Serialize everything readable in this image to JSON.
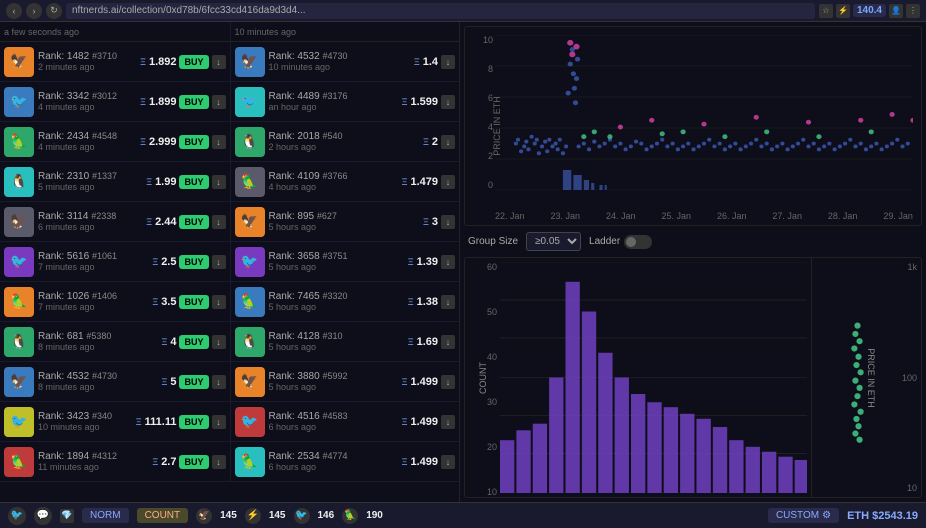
{
  "topbar": {
    "url": "nftnerds.ai/collection/0xd78b/6fcc33cd416da9d3d4...",
    "eth_price": "140.4"
  },
  "sales": [
    {
      "rank": "1482",
      "id": "#3710",
      "price": "1.892",
      "time": "2 minutes ago",
      "has_buy": true,
      "bg": "bg-orange",
      "emoji": "🦅"
    },
    {
      "rank": "3342",
      "id": "#3012",
      "price": "1.899",
      "time": "4 minutes ago",
      "has_buy": true,
      "bg": "bg-blue",
      "emoji": "🐦"
    },
    {
      "rank": "2434",
      "id": "#4548",
      "price": "2.999",
      "time": "4 minutes ago",
      "has_buy": true,
      "bg": "bg-green",
      "emoji": "🦜"
    },
    {
      "rank": "2310",
      "id": "#1337",
      "price": "1.99",
      "time": "5 minutes ago",
      "has_buy": true,
      "bg": "bg-teal",
      "emoji": "🐧"
    },
    {
      "rank": "3114",
      "id": "#2338",
      "price": "2.44",
      "time": "6 minutes ago",
      "has_buy": true,
      "bg": "bg-gray",
      "emoji": "🦅"
    },
    {
      "rank": "5616",
      "id": "#1061",
      "price": "2.5",
      "time": "7 minutes ago",
      "has_buy": true,
      "bg": "bg-purple",
      "emoji": "🐦"
    },
    {
      "rank": "1026",
      "id": "#1406",
      "price": "3.5",
      "time": "7 minutes ago",
      "has_buy": true,
      "bg": "bg-orange",
      "emoji": "🦜"
    },
    {
      "rank": "681",
      "id": "#5380",
      "price": "4",
      "time": "8 minutes ago",
      "has_buy": true,
      "bg": "bg-green",
      "emoji": "🐧"
    },
    {
      "rank": "4532",
      "id": "#4730",
      "price": "5",
      "time": "8 minutes ago",
      "has_buy": true,
      "bg": "bg-blue",
      "emoji": "🦅"
    },
    {
      "rank": "3423",
      "id": "#340",
      "price": "111.11",
      "time": "10 minutes ago",
      "has_buy": true,
      "bg": "bg-yellow",
      "emoji": "🐦"
    },
    {
      "rank": "1894",
      "id": "#4312",
      "price": "2.7",
      "time": "11 minutes ago",
      "has_buy": true,
      "bg": "bg-red",
      "emoji": "🦜"
    }
  ],
  "sales_right": [
    {
      "rank": "4532",
      "id": "#4730",
      "price": "1.4",
      "time": "10 minutes ago",
      "bg": "bg-blue",
      "emoji": "🦅"
    },
    {
      "rank": "4489",
      "id": "#3176",
      "price": "1.599",
      "time": "an hour ago",
      "bg": "bg-teal",
      "emoji": "🐦"
    },
    {
      "rank": "2018",
      "id": "#540",
      "price": "2",
      "time": "2 hours ago",
      "bg": "bg-green",
      "emoji": "🐧"
    },
    {
      "rank": "4109",
      "id": "#3766",
      "price": "1.479",
      "time": "4 hours ago",
      "bg": "bg-gray",
      "emoji": "🦜"
    },
    {
      "rank": "895",
      "id": "#627",
      "price": "3",
      "time": "5 hours ago",
      "bg": "bg-orange",
      "emoji": "🦅"
    },
    {
      "rank": "3658",
      "id": "#3751",
      "price": "1.39",
      "time": "5 hours ago",
      "bg": "bg-purple",
      "emoji": "🐦"
    },
    {
      "rank": "7465",
      "id": "#3320",
      "price": "1.38",
      "time": "5 hours ago",
      "bg": "bg-blue",
      "emoji": "🦜"
    },
    {
      "rank": "4128",
      "id": "#310",
      "price": "1.69",
      "time": "5 hours ago",
      "bg": "bg-green",
      "emoji": "🐧"
    },
    {
      "rank": "3880",
      "id": "#5992",
      "price": "1.499",
      "time": "5 hours ago",
      "bg": "bg-orange",
      "emoji": "🦅"
    },
    {
      "rank": "4516",
      "id": "#4583",
      "price": "1.499",
      "time": "6 hours ago",
      "bg": "bg-red",
      "emoji": "🐦"
    },
    {
      "rank": "2534",
      "id": "#4774",
      "price": "1.499",
      "time": "6 hours ago",
      "bg": "bg-teal",
      "emoji": "🦜"
    }
  ],
  "chart": {
    "y_labels": [
      "10",
      "8",
      "6",
      "4",
      "2",
      "0"
    ],
    "x_labels": [
      "22. Jan",
      "23. Jan",
      "24. Jan",
      "25. Jan",
      "26. Jan",
      "27. Jan",
      "28. Jan",
      "29. Jan"
    ],
    "y_axis_label": "PRICE IN ETH"
  },
  "controls": {
    "group_size_label": "Group Size",
    "group_size_value": "≥0.05",
    "ladder_label": "Ladder"
  },
  "histogram": {
    "y_labels_left": [
      "60",
      "50",
      "40",
      "30",
      "20",
      "10"
    ],
    "y_labels_right": [
      "1k",
      "100",
      "10"
    ],
    "count_label": "COUNT",
    "price_label": "PRICE IN ETH"
  },
  "bottombar": {
    "norm_label": "NORM",
    "count_label": "COUNT",
    "stat1_val": "145",
    "stat2_val": "145",
    "stat3_val": "146",
    "stat4_val": "190",
    "custom_label": "CUSTOM",
    "eth_price": "ETH $2543.19"
  }
}
